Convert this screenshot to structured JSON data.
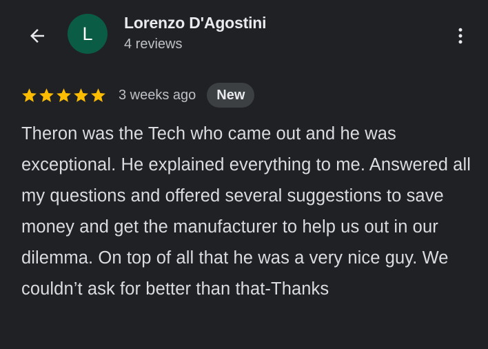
{
  "header": {
    "back_icon": "arrow-back-icon",
    "avatar": {
      "initial": "L",
      "color": "#0b5c45"
    },
    "user_name": "Lorenzo D'Agostini",
    "review_count": "4 reviews",
    "more_icon": "more-vert-icon"
  },
  "review": {
    "rating": 5,
    "max_rating": 5,
    "star_color": "#fbbc04",
    "time_ago": "3 weeks ago",
    "badge": "New",
    "text": "Theron was the Tech who came out and he was exceptional. He explained everything to me. Answered all my questions and offered several suggestions to save money and get the manufacturer to help us out in our dilemma. On top of all that he was a very nice guy. We couldn’t ask for better than that-Thanks"
  }
}
